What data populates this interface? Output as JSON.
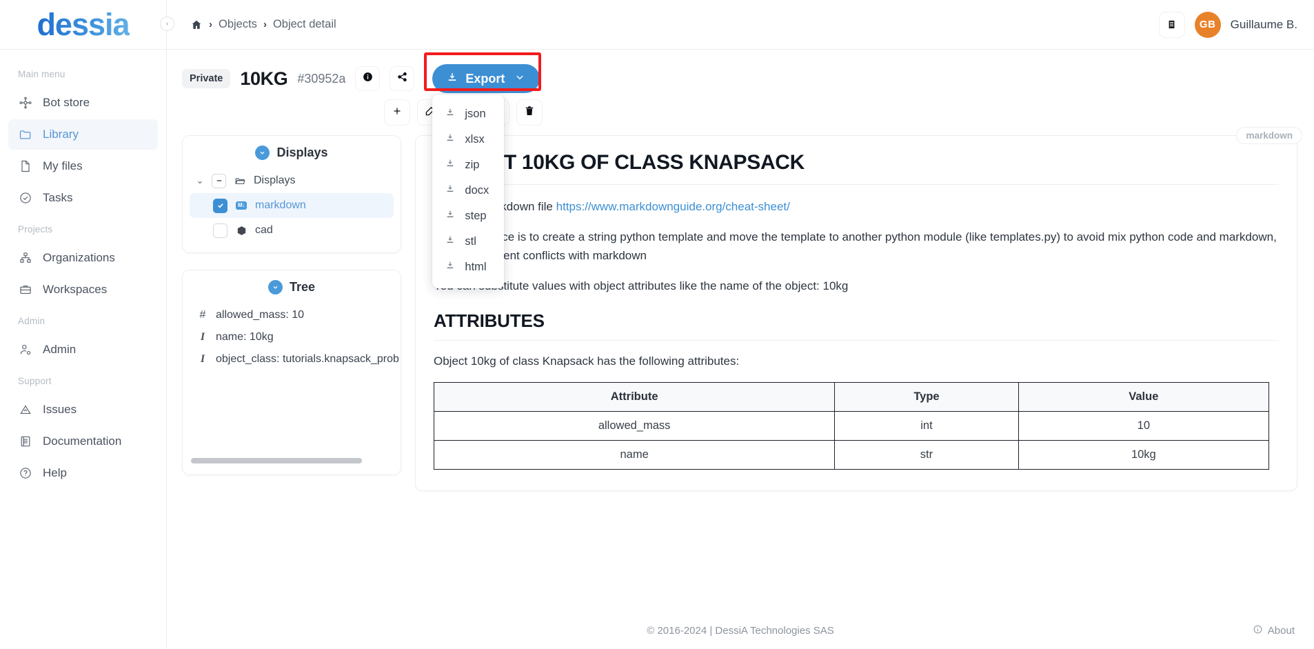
{
  "brand": {
    "name": "dessia"
  },
  "sidebar": {
    "sections": [
      {
        "label": "Main menu",
        "items": [
          {
            "label": "Bot store",
            "icon": "bot-store-icon",
            "active": false
          },
          {
            "label": "Library",
            "icon": "folder-icon",
            "active": true
          },
          {
            "label": "My files",
            "icon": "file-icon",
            "active": false
          },
          {
            "label": "Tasks",
            "icon": "check-circle-icon",
            "active": false
          }
        ]
      },
      {
        "label": "Projects",
        "items": [
          {
            "label": "Organizations",
            "icon": "org-chart-icon",
            "active": false
          },
          {
            "label": "Workspaces",
            "icon": "briefcase-icon",
            "active": false
          }
        ]
      },
      {
        "label": "Admin",
        "items": [
          {
            "label": "Admin",
            "icon": "user-gear-icon",
            "active": false
          }
        ]
      },
      {
        "label": "Support",
        "items": [
          {
            "label": "Issues",
            "icon": "warning-triangle-icon",
            "active": false
          },
          {
            "label": "Documentation",
            "icon": "book-icon",
            "active": false
          },
          {
            "label": "Help",
            "icon": "question-circle-icon",
            "active": false
          }
        ]
      }
    ]
  },
  "topbar": {
    "breadcrumb": {
      "home": "home-icon",
      "items": [
        "Objects",
        "Object detail"
      ],
      "separator": "›"
    },
    "notes_icon": "notes-icon",
    "user": {
      "initials": "GB",
      "name": "Guillaume B."
    }
  },
  "object": {
    "visibility": "Private",
    "title": "10KG",
    "id": "#30952a",
    "info_icon": "info-icon",
    "share_icon": "share-icon",
    "toolbar": [
      {
        "name": "add-button",
        "icon": "plus-icon"
      },
      {
        "name": "edit-button",
        "icon": "edit-icon"
      },
      {
        "name": "rename-button",
        "icon": "tag-icon"
      },
      {
        "name": "refresh-button",
        "icon": "refresh-icon"
      },
      {
        "name": "delete-button",
        "icon": "trash-icon"
      }
    ]
  },
  "export": {
    "label": "Export",
    "download_icon": "download-icon",
    "chevron_icon": "chevron-down-icon",
    "highlighted": true,
    "highlight_color": "#f21c1c",
    "accent_color": "#3d8fd4",
    "open": true,
    "items": [
      "json",
      "xlsx",
      "zip",
      "docx",
      "step",
      "stl",
      "html"
    ]
  },
  "displays_panel": {
    "title": "Displays",
    "toggle_icon": "chevron-down-circle-icon",
    "root": {
      "label": "Displays",
      "icon": "folder-open-icon",
      "expanded": true,
      "checkbox": "indeterminate"
    },
    "children": [
      {
        "label": "markdown",
        "icon": "markdown-icon",
        "checked": true,
        "selected": true
      },
      {
        "label": "cad",
        "icon": "cube-icon",
        "checked": false,
        "selected": false
      }
    ]
  },
  "tree_panel": {
    "title": "Tree",
    "toggle_icon": "chevron-down-circle-icon",
    "attributes": [
      {
        "glyph": "#",
        "text": "allowed_mass: 10"
      },
      {
        "glyph": "I",
        "text": "name: 10kg"
      },
      {
        "glyph": "I",
        "text": "object_class: tutorials.knapsack_prob"
      }
    ],
    "scrollbar": "horizontal-scrollbar"
  },
  "markdown": {
    "tag": "markdown",
    "h1": "OBJECT 10KG OF CLASS KNAPSACK",
    "p1_before": "This is a markdown file ",
    "p1_link": "https://www.markdownguide.org/cheat-sheet/",
    "p2": "A good practice is to create a string python template and move the template to another python module (like templates.py) to avoid mix python code and markdown, as python indent conflicts with markdown",
    "p3": "You can substitute values with object attributes like the name of the object: 10kg",
    "h2": "ATTRIBUTES",
    "intro": "Object 10kg of class Knapsack has the following attributes:",
    "table": {
      "headers": [
        "Attribute",
        "Type",
        "Value"
      ],
      "rows": [
        [
          "allowed_mass",
          "int",
          "10"
        ],
        [
          "name",
          "str",
          "10kg"
        ]
      ]
    }
  },
  "footer": {
    "copyright": "© 2016-2024 | DessiA Technologies SAS",
    "about_label": "About",
    "about_icon": "info-circle-icon"
  }
}
